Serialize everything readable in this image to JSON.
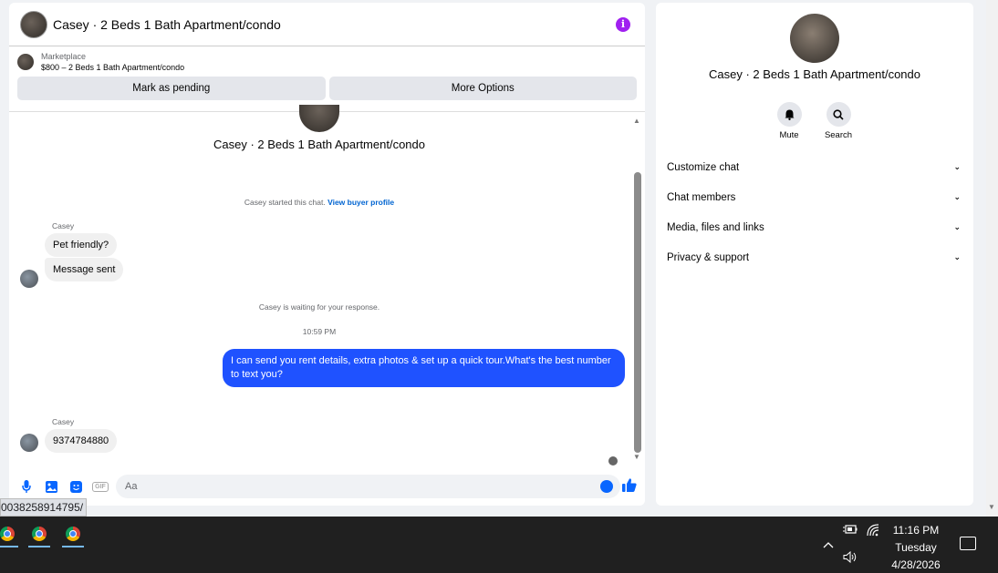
{
  "chat": {
    "header_title": "Casey · 2 Beds 1 Bath Apartment/condo",
    "info_icon": "i",
    "marketplace": {
      "label": "Marketplace",
      "item": "$800 – 2 Beds 1 Bath Apartment/condo",
      "buttons": [
        "Mark as pending",
        "More Options"
      ]
    },
    "thread_title": "Casey · 2 Beds 1 Bath Apartment/condo",
    "started_text": "Casey started this chat.",
    "view_profile_link": "View buyer profile",
    "messages": [
      {
        "sender": "Casey",
        "text": "Pet friendly?"
      },
      {
        "text": "Message sent"
      }
    ],
    "waiting_text": "Casey is waiting for your response.",
    "timestamp": "10:59 PM",
    "outgoing": "I can send you rent details, extra photos & set up a quick tour.What's the best number to text you?",
    "reply_sender": "Casey",
    "reply_text": "9374784880",
    "composer_placeholder": "Aa",
    "gif_label": "GIF"
  },
  "side": {
    "title": "Casey · 2 Beds 1 Bath Apartment/condo",
    "actions": [
      "Mute",
      "Search"
    ],
    "items": [
      "Customize chat",
      "Chat members",
      "Media, files and links",
      "Privacy & support"
    ]
  },
  "url_tooltip": "0038258914795/",
  "taskbar": {
    "time": "11:16 PM",
    "day": "Tuesday",
    "date": "4/28/2026"
  }
}
